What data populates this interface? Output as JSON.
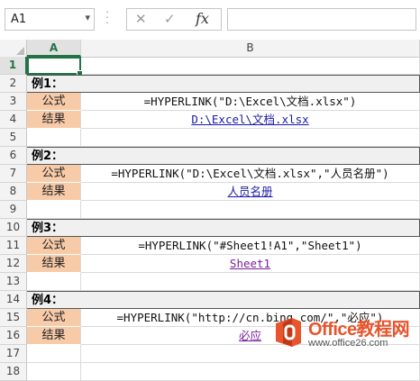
{
  "formula_bar": {
    "name_box": "A1",
    "cancel_icon": "cancel-icon",
    "confirm_icon": "confirm-icon",
    "fx_label": "fx",
    "formula": ""
  },
  "columns": [
    "A",
    "B"
  ],
  "rows": [
    {
      "num": "1",
      "a": "",
      "b": "",
      "kind": "plain"
    },
    {
      "num": "2",
      "a": "例1：",
      "b": "",
      "kind": "title"
    },
    {
      "num": "3",
      "a": "公式",
      "b": "=HYPERLINK(\"D:\\Excel\\文档.xlsx\")",
      "kind": "formula"
    },
    {
      "num": "4",
      "a": "结果",
      "b": "D:\\Excel\\文档.xlsx",
      "kind": "link"
    },
    {
      "num": "5",
      "a": "",
      "b": "",
      "kind": "plain"
    },
    {
      "num": "6",
      "a": "例2：",
      "b": "",
      "kind": "title"
    },
    {
      "num": "7",
      "a": "公式",
      "b": "=HYPERLINK(\"D:\\Excel\\文档.xlsx\",\"人员名册\")",
      "kind": "formula"
    },
    {
      "num": "8",
      "a": "结果",
      "b": "人员名册",
      "kind": "link"
    },
    {
      "num": "9",
      "a": "",
      "b": "",
      "kind": "plain"
    },
    {
      "num": "10",
      "a": "例3：",
      "b": "",
      "kind": "title"
    },
    {
      "num": "11",
      "a": "公式",
      "b": "=HYPERLINK(\"#Sheet1!A1\",\"Sheet1\")",
      "kind": "formula"
    },
    {
      "num": "12",
      "a": "结果",
      "b": "Sheet1",
      "kind": "visited"
    },
    {
      "num": "13",
      "a": "",
      "b": "",
      "kind": "plain"
    },
    {
      "num": "14",
      "a": "例4：",
      "b": "",
      "kind": "title"
    },
    {
      "num": "15",
      "a": "公式",
      "b": "=HYPERLINK(\"http://cn.bing.com/\",\"必应\")",
      "kind": "formula"
    },
    {
      "num": "16",
      "a": "结果",
      "b": "必应",
      "kind": "visited"
    },
    {
      "num": "17",
      "a": "",
      "b": "",
      "kind": "plain"
    },
    {
      "num": "18",
      "a": "",
      "b": "",
      "kind": "plain"
    }
  ],
  "watermark": {
    "title": "Office教程网",
    "url": "www.office26.com"
  },
  "colors": {
    "accent": "#217346",
    "label_fill": "#f8cba8",
    "title_fill": "#f0f0f0",
    "link": "#1a1aa8",
    "visited_link": "#7a1f9a",
    "watermark": "#e8542c"
  }
}
